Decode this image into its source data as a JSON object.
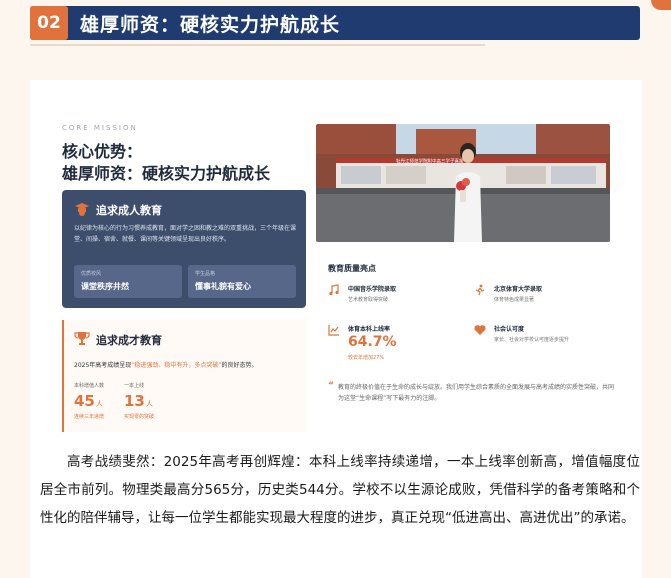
{
  "header": {
    "number": "02",
    "title": "雄厚师资：硬核实力护航成长"
  },
  "card": {
    "core_label": "CORE MISSION",
    "heading_line1": "核心优势：",
    "heading_line2": "雄厚师资：硬核实力护航成长",
    "pursuit_adult": {
      "title": "追求成人教育",
      "desc": "以纪律为核心的行为习惯养成教育，面对学之困和教之难的双重挑战，三个年级在课堂、间操、宿舍、就餐、课间等关键领域呈现出良好秩序。",
      "sub1_label": "优质校风",
      "sub1_value": "课堂秩序井然",
      "sub2_label": "学生品格",
      "sub2_value": "懂事礼貌有爱心"
    },
    "pursuit_talent": {
      "title": "追求成才教育",
      "desc_prefix": "2025年高考成绩呈现",
      "desc_highlight": "“稳进强劲、稳中有升，多点突破”",
      "desc_suffix": "的良好态势。",
      "stat1_label": "本科增值人数",
      "stat1_value": "45",
      "stat1_unit": "人",
      "stat1_sub": "连续三年递增",
      "stat2_label": "一本上线",
      "stat2_value": "13",
      "stat2_unit": "人",
      "stat2_sub": "实现零的突破"
    },
    "photo_banner_text": "牡丹江师范学院附中高三学子喜报",
    "quality": {
      "title": "教育质量亮点",
      "items": [
        {
          "title": "中国音乐学院录取",
          "desc": "艺术教育取得突破",
          "icon": "music-icon"
        },
        {
          "title": "北京体育大学录取",
          "desc": "体育特色成果显著",
          "icon": "runner-icon"
        },
        {
          "title": "体育本科上线率",
          "value": "64.7%",
          "desc": "较去年增加27%",
          "icon": "chart-icon"
        },
        {
          "title": "社会认可度",
          "desc": "家长、社会对学校认可度逐步提升",
          "icon": "heart-icon"
        }
      ],
      "quote": "教育的终极价值在于生命的成长与绽放。我们用学生综合素质的全面发展与高考成绩的实质性突破，共同为这堂“生命课程”写下最有力的注脚。"
    }
  },
  "paragraph": "高考战绩斐然：2025年高考再创辉煌：本科上线率持续递增，一本上线率创新高，增值幅度位居全市前列。物理类最高分565分，历史类544分。学校不以生源论成败，凭借科学的备考策略和个性化的陪伴辅导，让每一位学生都能实现最大程度的进步，真正兑现“低进高出、高进优出”的承诺。",
  "colors": {
    "accent": "#e0733c",
    "navy": "#1f3b70",
    "card_navy": "#3d4e6c"
  }
}
